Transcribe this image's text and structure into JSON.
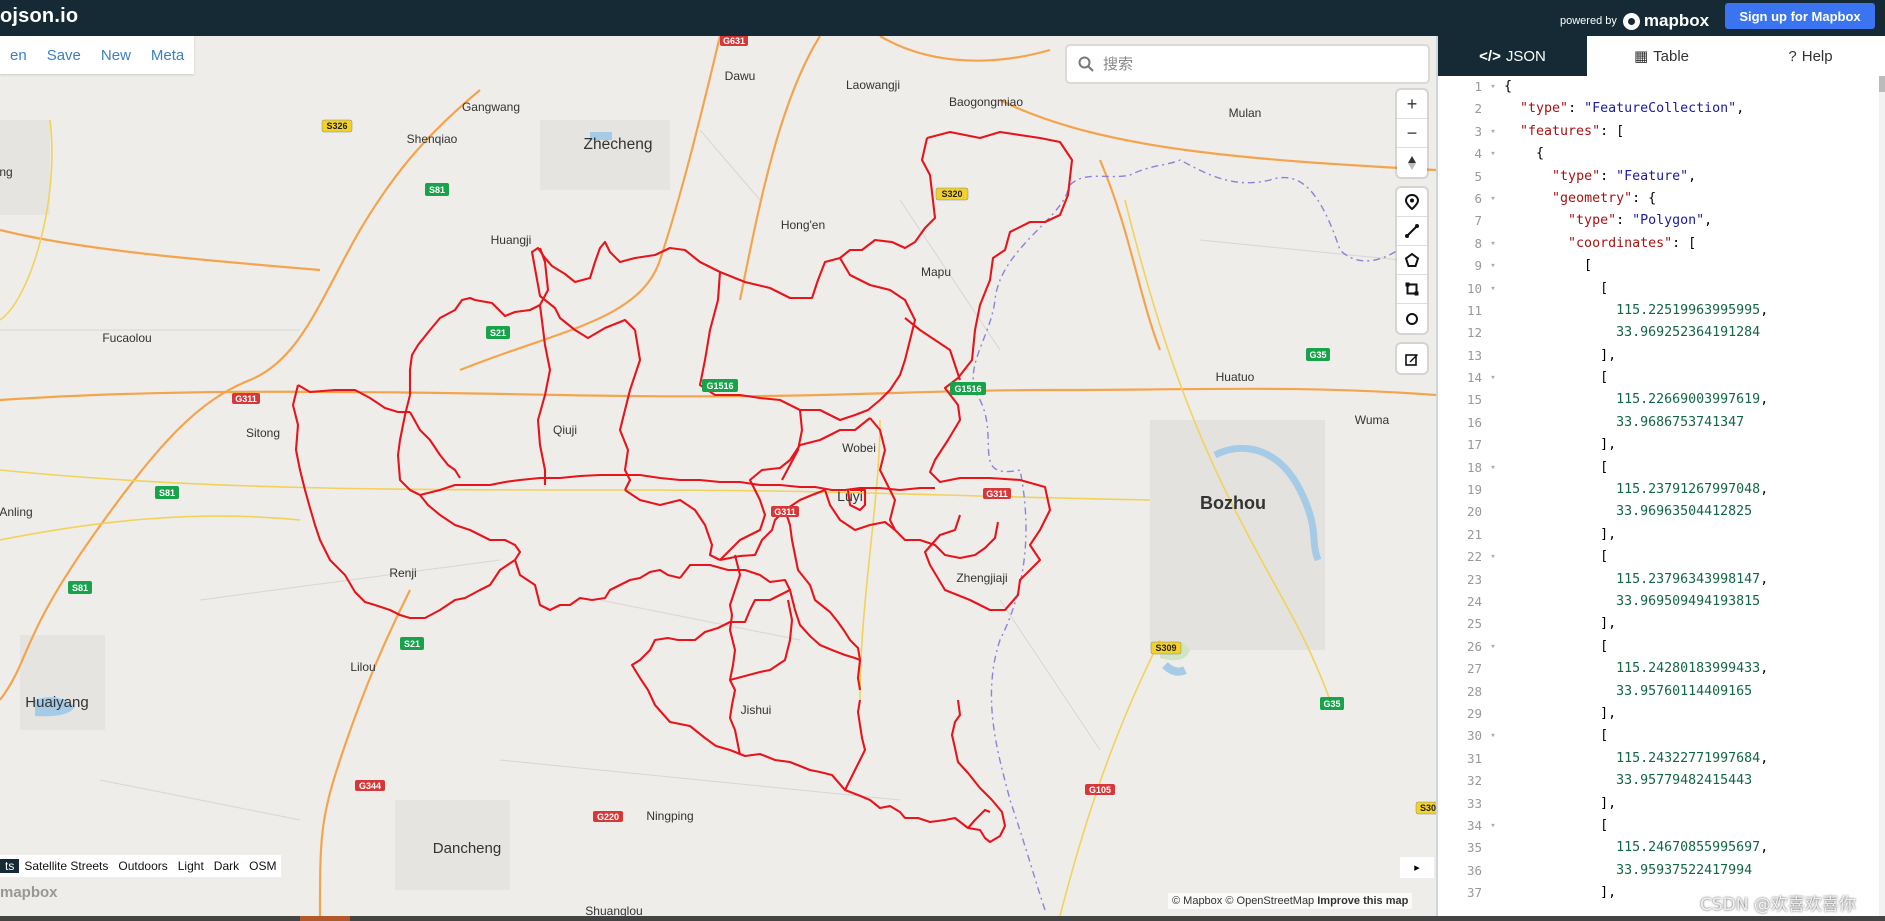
{
  "app": {
    "brand": "ojson.io",
    "powered_by": "powered by",
    "mapbox_brand": "mapbox",
    "signup_label": "Sign up for Mapbox"
  },
  "menu": [
    "en",
    "Save",
    "New",
    "Meta"
  ],
  "search": {
    "placeholder": "搜索"
  },
  "map_controls": [
    "+",
    "−",
    "▲"
  ],
  "draw_tools": [
    "marker-icon",
    "line-icon",
    "polygon-icon",
    "rectangle-icon",
    "circle-icon"
  ],
  "edit_tool": "edit-icon",
  "map_styles": [
    "ts",
    "Satellite Streets",
    "Outdoors",
    "Light",
    "Dark",
    "OSM"
  ],
  "attribution": {
    "mapbox": "© Mapbox",
    "osm": "© OpenStreetMap",
    "improve": "Improve this map"
  },
  "collapse_arrow": "▸",
  "watermark": "mapbox",
  "csdn": "CSDN @欢喜欢喜你",
  "places": [
    {
      "name": "Dawu"
    },
    {
      "name": "Laowangji"
    },
    {
      "name": "Gangwang"
    },
    {
      "name": "Baogongmiao"
    },
    {
      "name": "Mulan"
    },
    {
      "name": "Shenqiao"
    },
    {
      "name": "Zhecheng"
    },
    {
      "name": "Hong'en"
    },
    {
      "name": "Huangji"
    },
    {
      "name": "Mapu"
    },
    {
      "name": "Fucaolou"
    },
    {
      "name": "Huatuo"
    },
    {
      "name": "Sitong"
    },
    {
      "name": "Qiuji"
    },
    {
      "name": "Wobei"
    },
    {
      "name": "Wuma"
    },
    {
      "name": "Luyi"
    },
    {
      "name": "Bozhou"
    },
    {
      "name": "Anling"
    },
    {
      "name": "Renji"
    },
    {
      "name": "Zhengjiaji"
    },
    {
      "name": "Lilou"
    },
    {
      "name": "Huaiyang"
    },
    {
      "name": "Jishui"
    },
    {
      "name": "Ningping"
    },
    {
      "name": "Dancheng"
    },
    {
      "name": "Shuanglou"
    },
    {
      "name": "ng"
    }
  ],
  "road_shields": [
    "G631",
    "S326",
    "S81",
    "S21",
    "S320",
    "G1516",
    "G1516",
    "G311",
    "G35",
    "S81",
    "G311",
    "G311",
    "S81",
    "S21",
    "S309",
    "G35",
    "G344",
    "G220",
    "G105",
    "S30"
  ],
  "panel": {
    "tabs": [
      {
        "label": "JSON",
        "icon": "code-icon"
      },
      {
        "label": "Table",
        "icon": "table-icon"
      },
      {
        "label": "Help",
        "icon": "help-icon"
      }
    ]
  },
  "code_lines": [
    {
      "n": "1",
      "f": "▾",
      "t": "{"
    },
    {
      "n": "2",
      "f": "",
      "t": "  \"type\": \"FeatureCollection\","
    },
    {
      "n": "3",
      "f": "▾",
      "t": "  \"features\": ["
    },
    {
      "n": "4",
      "f": "▾",
      "t": "    {"
    },
    {
      "n": "5",
      "f": "",
      "t": "      \"type\": \"Feature\","
    },
    {
      "n": "6",
      "f": "▾",
      "t": "      \"geometry\": {"
    },
    {
      "n": "7",
      "f": "",
      "t": "        \"type\": \"Polygon\","
    },
    {
      "n": "8",
      "f": "▾",
      "t": "        \"coordinates\": ["
    },
    {
      "n": "9",
      "f": "▾",
      "t": "          ["
    },
    {
      "n": "10",
      "f": "▾",
      "t": "            ["
    },
    {
      "n": "11",
      "f": "",
      "t": "              115.22519963995995,"
    },
    {
      "n": "12",
      "f": "",
      "t": "              33.969252364191284"
    },
    {
      "n": "13",
      "f": "",
      "t": "            ],"
    },
    {
      "n": "14",
      "f": "▾",
      "t": "            ["
    },
    {
      "n": "15",
      "f": "",
      "t": "              115.22669003997619,"
    },
    {
      "n": "16",
      "f": "",
      "t": "              33.9686753741347"
    },
    {
      "n": "17",
      "f": "",
      "t": "            ],"
    },
    {
      "n": "18",
      "f": "▾",
      "t": "            ["
    },
    {
      "n": "19",
      "f": "",
      "t": "              115.23791267997048,"
    },
    {
      "n": "20",
      "f": "",
      "t": "              33.96963504412825"
    },
    {
      "n": "21",
      "f": "",
      "t": "            ],"
    },
    {
      "n": "22",
      "f": "▾",
      "t": "            ["
    },
    {
      "n": "23",
      "f": "",
      "t": "              115.23796343998147,"
    },
    {
      "n": "24",
      "f": "",
      "t": "              33.969509494193815"
    },
    {
      "n": "25",
      "f": "",
      "t": "            ],"
    },
    {
      "n": "26",
      "f": "▾",
      "t": "            ["
    },
    {
      "n": "27",
      "f": "",
      "t": "              115.24280183999433,"
    },
    {
      "n": "28",
      "f": "",
      "t": "              33.95760114409165"
    },
    {
      "n": "29",
      "f": "",
      "t": "            ],"
    },
    {
      "n": "30",
      "f": "▾",
      "t": "            ["
    },
    {
      "n": "31",
      "f": "",
      "t": "              115.24322771997684,"
    },
    {
      "n": "32",
      "f": "",
      "t": "              33.95779482415443"
    },
    {
      "n": "33",
      "f": "",
      "t": "            ],"
    },
    {
      "n": "34",
      "f": "▾",
      "t": "            ["
    },
    {
      "n": "35",
      "f": "",
      "t": "              115.24670855995697,"
    },
    {
      "n": "36",
      "f": "",
      "t": "              33.95937522417994"
    },
    {
      "n": "37",
      "f": "",
      "t": "            ],"
    }
  ]
}
